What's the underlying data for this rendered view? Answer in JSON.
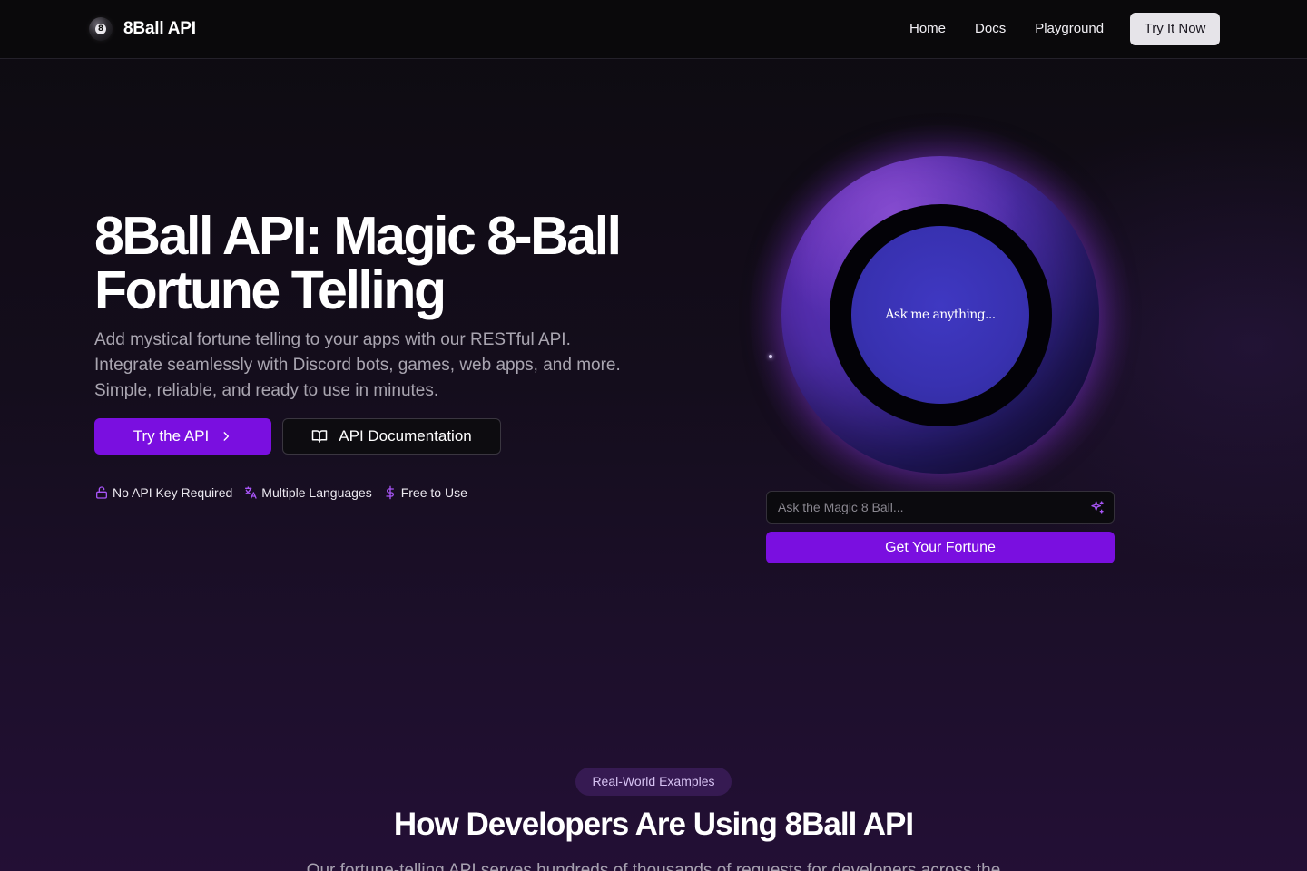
{
  "nav": {
    "brand_mark": "8",
    "brand_name": "8Ball API",
    "links": [
      "Home",
      "Docs",
      "Playground"
    ],
    "cta_label": "Try It Now"
  },
  "hero": {
    "title_line1": "8Ball API: Magic 8-Ball",
    "title_line2": "Fortune Telling",
    "description": "Add mystical fortune telling to your apps with our RESTful API. Integrate seamlessly with Discord bots, games, web apps, and more. Simple, reliable, and ready to use in minutes.",
    "primary_button": "Try the API",
    "secondary_button": "API Documentation",
    "features": [
      {
        "label": "No API Key Required",
        "icon": "lock-open-icon"
      },
      {
        "label": "Multiple Languages",
        "icon": "languages-icon"
      },
      {
        "label": "Free to Use",
        "icon": "dollar-icon"
      }
    ]
  },
  "ball": {
    "window_text": "Ask me anything...",
    "input_placeholder": "Ask the Magic 8 Ball...",
    "input_value": "",
    "input_icon": "sparkles-icon",
    "submit_label": "Get Your Fortune"
  },
  "examples": {
    "badge": "Real-World Examples",
    "title": "How Developers Are Using 8Ball API",
    "subtitle": "Our fortune-telling API serves hundreds of thousands of requests for developers across the"
  },
  "colors": {
    "accent": "#7a0fe0",
    "feature_icon": "#a855f7",
    "background": "#0b0a0d"
  }
}
